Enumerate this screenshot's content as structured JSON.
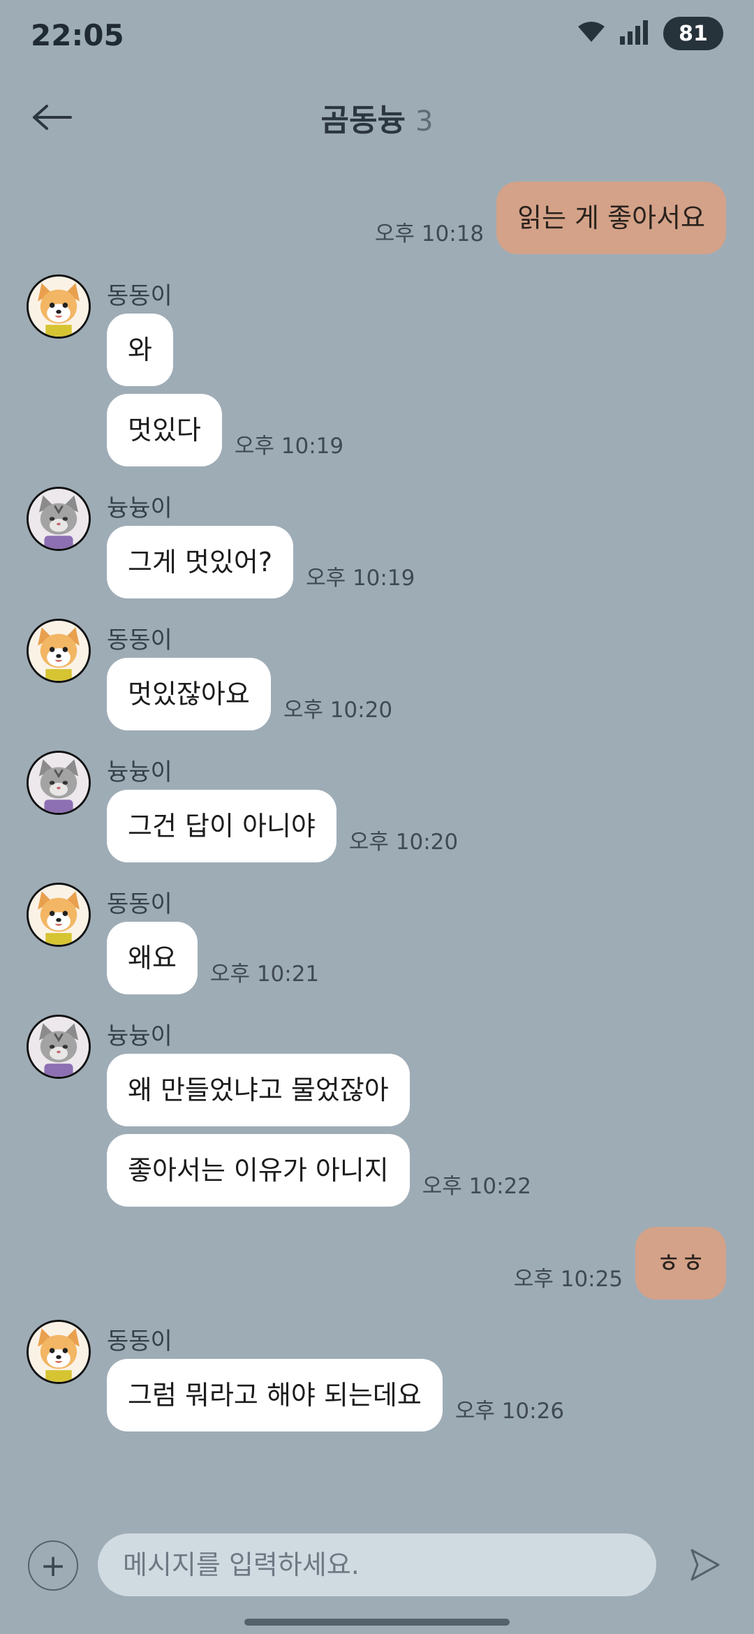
{
  "status_bar": {
    "time": "22:05",
    "battery": "81"
  },
  "header": {
    "title": "곰동늉",
    "member_count": "3"
  },
  "participants": {
    "dong": "동동이",
    "nyu": "늉늉이"
  },
  "messages": [
    {
      "side": "out",
      "text": "읽는 게 좋아서요",
      "time": "오후 10:18"
    },
    {
      "side": "in",
      "sender": "동동이",
      "avatar": "dog-avatar",
      "text": "와"
    },
    {
      "side": "in",
      "text": "멋있다",
      "time": "오후 10:19"
    },
    {
      "side": "in",
      "sender": "늉늉이",
      "avatar": "cat-avatar",
      "text": "그게 멋있어?",
      "time": "오후 10:19"
    },
    {
      "side": "in",
      "sender": "동동이",
      "avatar": "dog-avatar",
      "text": "멋있잖아요",
      "time": "오후 10:20"
    },
    {
      "side": "in",
      "sender": "늉늉이",
      "avatar": "cat-avatar",
      "text": "그건 답이 아니야",
      "time": "오후 10:20"
    },
    {
      "side": "in",
      "sender": "동동이",
      "avatar": "dog-avatar",
      "text": "왜요",
      "time": "오후 10:21"
    },
    {
      "side": "in",
      "sender": "늉늉이",
      "avatar": "cat-avatar",
      "text": "왜 만들었냐고 물었잖아"
    },
    {
      "side": "in",
      "text": "좋아서는 이유가 아니지",
      "time": "오후 10:22"
    },
    {
      "side": "out",
      "text": "ㅎㅎ",
      "time": "오후 10:25"
    },
    {
      "side": "in",
      "sender": "동동이",
      "avatar": "dog-avatar",
      "text": "그럼 뭐라고 해야 되는데요",
      "time": "오후 10:26"
    }
  ],
  "composer": {
    "placeholder": "메시지를 입력하세요.",
    "plus": "+"
  },
  "colors": {
    "background": "#9EACB6",
    "outgoing_bubble": "#D4A288",
    "incoming_bubble": "#FFFFFF",
    "input": "#D0DAE1"
  }
}
